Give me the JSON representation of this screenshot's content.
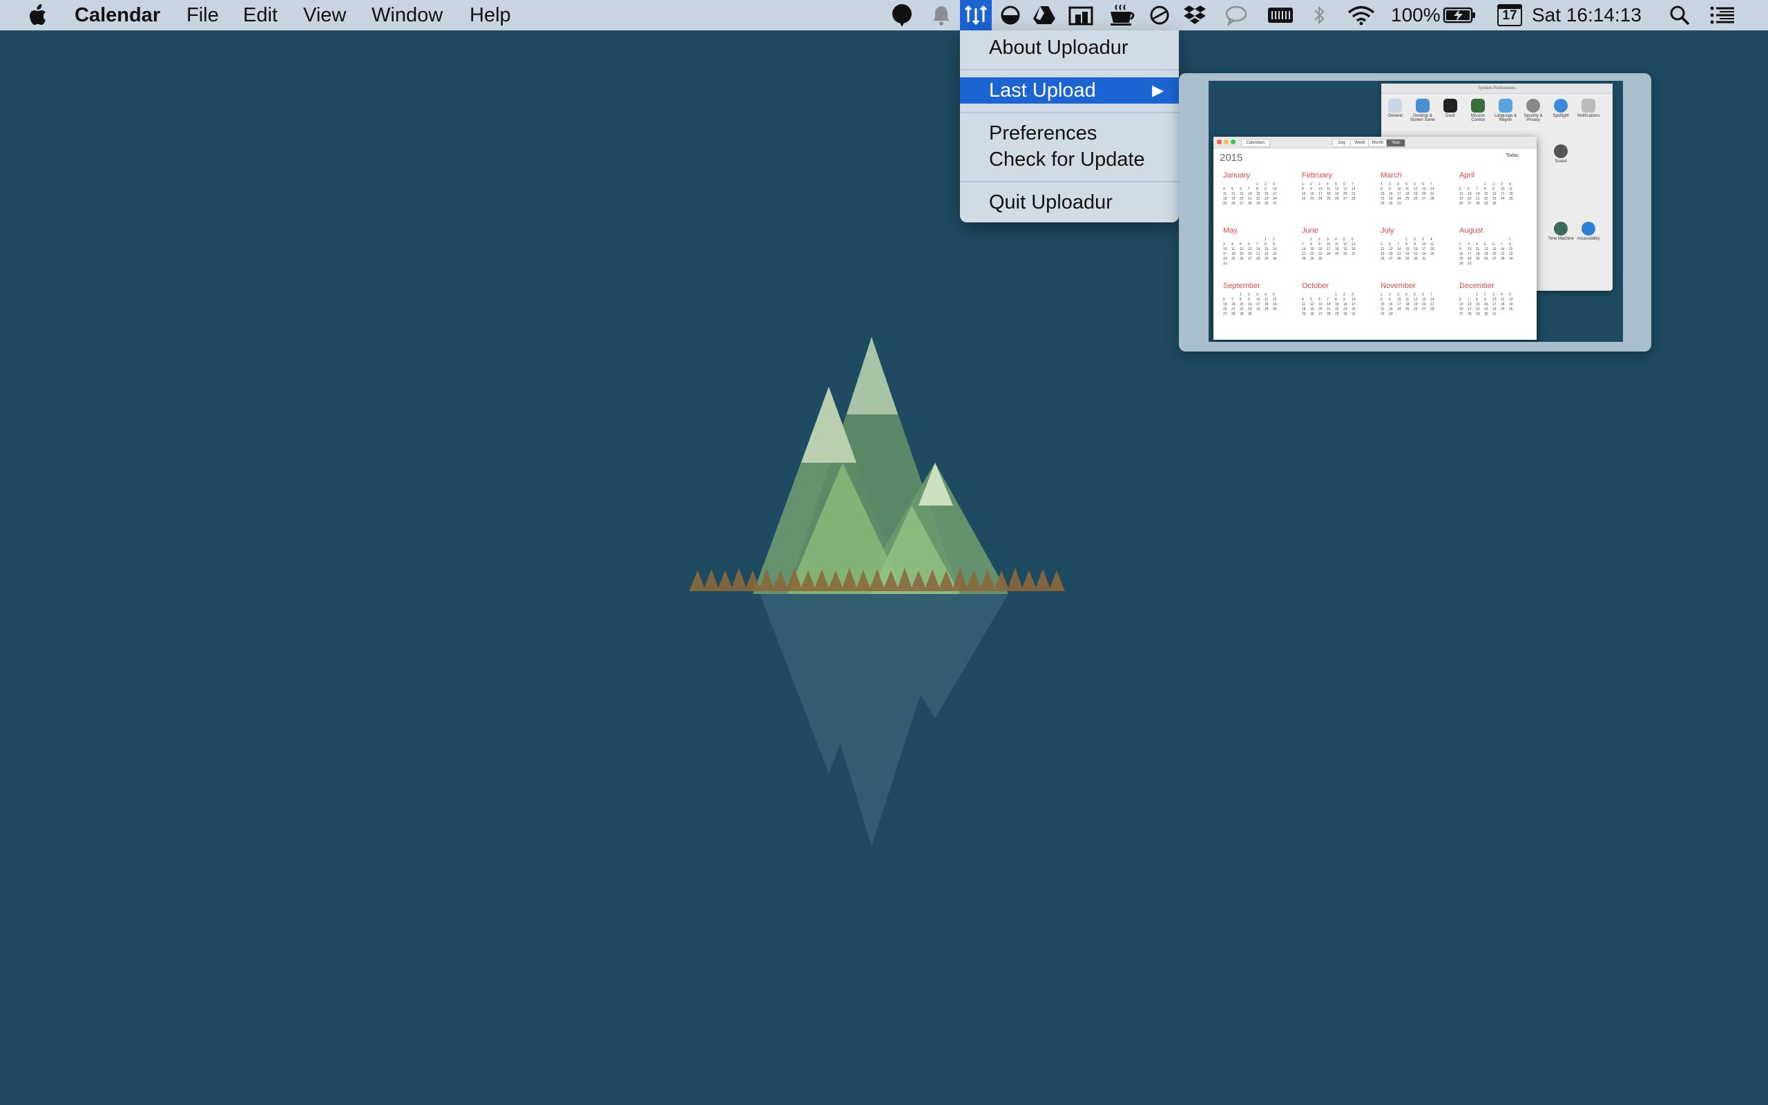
{
  "menubar": {
    "apple_icon": "apple-logo",
    "app_name": "Calendar",
    "menus": [
      "File",
      "Edit",
      "View",
      "Window",
      "Help"
    ],
    "status": {
      "battery_percent": "100%",
      "date_badge": "17",
      "clock": "Sat 16:14:13"
    }
  },
  "menu": {
    "items": [
      "About Uploadur",
      "Last Upload",
      "Preferences",
      "Check for Update",
      "Quit Uploadur"
    ],
    "submenu_arrow": "▶"
  },
  "preview": {
    "calendar": {
      "window_title": "Calendars",
      "year": "2015",
      "today_label": "Today",
      "view_tabs": [
        "Day",
        "Week",
        "Month",
        "Year"
      ],
      "months": [
        "January",
        "February",
        "March",
        "April",
        "May",
        "June",
        "July",
        "August",
        "September",
        "October",
        "November",
        "December"
      ]
    },
    "system_preferences": {
      "title": "System Preferences",
      "icons": [
        "General",
        "Desktop & Screen Saver",
        "Dock",
        "Mission Control",
        "Language & Region",
        "Security & Privacy",
        "Spotlight",
        "Notifications",
        "Sound",
        "Time Machine",
        "Accessibility"
      ]
    }
  },
  "colors": {
    "desktop": "#1e4a62",
    "menubar": "#cddae4",
    "highlight": "#1b64d2",
    "calendar_month": "#e5454e"
  }
}
